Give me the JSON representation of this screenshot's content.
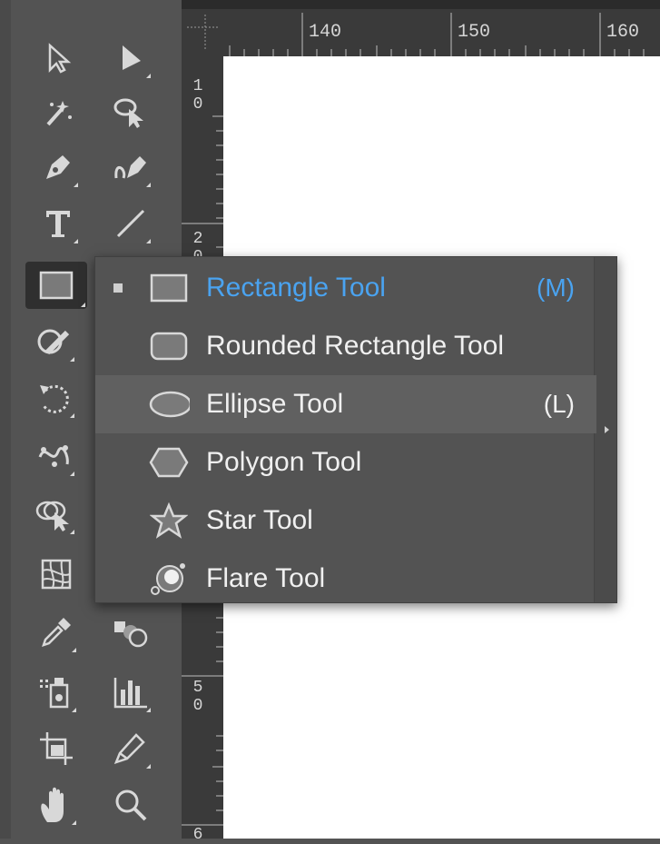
{
  "ruler": {
    "top_labels": [
      "140",
      "150",
      "160"
    ],
    "left_labels": [
      [
        "1",
        "0"
      ],
      [
        "2",
        "0"
      ],
      [
        "5",
        "0"
      ],
      [
        "6"
      ]
    ]
  },
  "toolbar": {
    "tools": [
      {
        "name": "selection-tool",
        "icon": "arrow-outline-icon"
      },
      {
        "name": "direct-selection-tool",
        "icon": "arrow-filled-icon"
      },
      {
        "name": "magic-wand-tool",
        "icon": "magic-wand-icon"
      },
      {
        "name": "lasso-tool",
        "icon": "lasso-icon"
      },
      {
        "name": "pen-tool",
        "icon": "pen-icon"
      },
      {
        "name": "curvature-tool",
        "icon": "curvature-icon"
      },
      {
        "name": "type-tool",
        "icon": "type-icon"
      },
      {
        "name": "line-segment-tool",
        "icon": "line-icon"
      },
      {
        "name": "rectangle-tool",
        "icon": "rectangle-icon"
      },
      {
        "name": "shaper-tool",
        "icon": "shaper-icon"
      },
      {
        "name": "rotate-tool",
        "icon": "rotate-icon"
      },
      {
        "name": "puppet-warp-tool",
        "icon": "puppet-warp-icon"
      },
      {
        "name": "shape-builder-tool",
        "icon": "shape-builder-icon"
      },
      {
        "name": "mesh-tool",
        "icon": "mesh-icon"
      },
      {
        "name": "eyedropper-tool",
        "icon": "eyedropper-icon"
      },
      {
        "name": "blend-tool",
        "icon": "blend-icon"
      },
      {
        "name": "symbol-sprayer-tool",
        "icon": "symbol-sprayer-icon"
      },
      {
        "name": "column-graph-tool",
        "icon": "column-graph-icon"
      },
      {
        "name": "artboard-tool",
        "icon": "artboard-icon"
      },
      {
        "name": "slice-tool",
        "icon": "slice-icon"
      },
      {
        "name": "hand-tool",
        "icon": "hand-icon"
      },
      {
        "name": "zoom-tool",
        "icon": "zoom-icon"
      }
    ]
  },
  "flyout": {
    "items": [
      {
        "label": "Rectangle Tool",
        "shortcut": "(M)",
        "icon": "rectangle-icon",
        "selected": true
      },
      {
        "label": "Rounded Rectangle Tool",
        "shortcut": "",
        "icon": "rounded-rectangle-icon"
      },
      {
        "label": "Ellipse Tool",
        "shortcut": "(L)",
        "icon": "ellipse-icon",
        "hover": true
      },
      {
        "label": "Polygon Tool",
        "shortcut": "",
        "icon": "polygon-icon"
      },
      {
        "label": "Star Tool",
        "shortcut": "",
        "icon": "star-icon"
      },
      {
        "label": "Flare Tool",
        "shortcut": "",
        "icon": "flare-icon"
      }
    ]
  },
  "colors": {
    "panel": "#535353",
    "ruler": "#3a3a3a",
    "selected_text": "#4aa3f0",
    "canvas": "#ffffff"
  }
}
